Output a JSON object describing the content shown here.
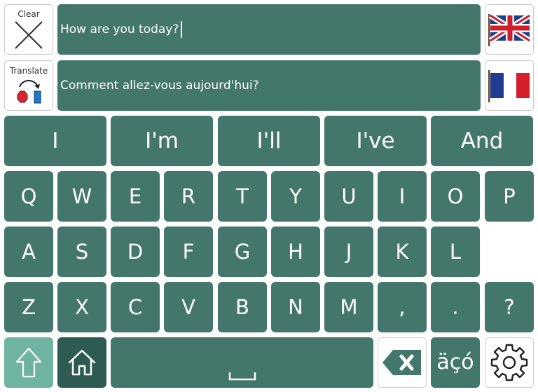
{
  "toolbar": {
    "clear_label": "Clear",
    "translate_label": "Translate"
  },
  "input": {
    "source_text": "How are you today?",
    "translated_text": "Comment allez-vous aujourd'hui?"
  },
  "flags": {
    "source": "uk-flag-icon",
    "target": "france-flag-icon"
  },
  "predictions": [
    "I",
    "I'm",
    "I'll",
    "I've",
    "And"
  ],
  "keyboard": {
    "row1": [
      "Q",
      "W",
      "E",
      "R",
      "T",
      "Y",
      "U",
      "I",
      "O",
      "P"
    ],
    "row2": [
      "A",
      "S",
      "D",
      "F",
      "G",
      "H",
      "J",
      "K",
      "L"
    ],
    "row3": [
      "Z",
      "X",
      "C",
      "V",
      "B",
      "N",
      "M",
      ",",
      ".",
      "?"
    ],
    "accent_label": "äçó",
    "shift_icon": "shift-arrow-icon",
    "home_icon": "home-icon",
    "space_icon": "space-bar-icon",
    "backspace_icon": "backspace-icon",
    "settings_icon": "gear-icon"
  },
  "colors": {
    "key": "#44776c",
    "shift": "#6fb3a1",
    "home": "#2d5b51"
  }
}
